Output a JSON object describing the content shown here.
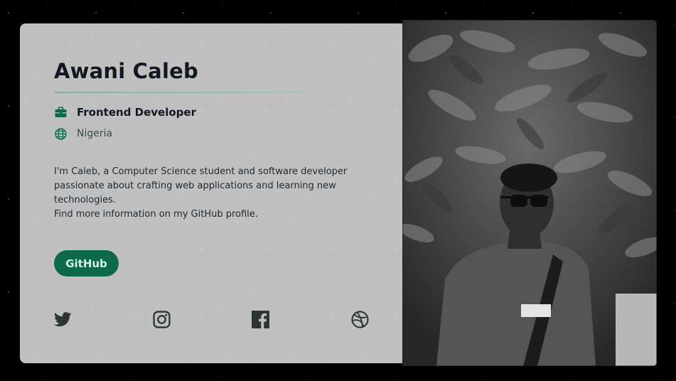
{
  "profile": {
    "name": "Awani Caleb",
    "role": "Frontend Developer",
    "location": "Nigeria",
    "bio_lines": [
      "I'm Caleb, a Computer Science student and software developer passionate about crafting web applications and learning new technologies.",
      "Find more information on my GitHub profile."
    ]
  },
  "actions": {
    "github_label": "GitHub"
  },
  "icons": {
    "role": "briefcase-icon",
    "location": "globe-icon",
    "social": [
      "twitter-icon",
      "instagram-icon",
      "facebook-icon",
      "dribbble-icon"
    ]
  },
  "colors": {
    "accent": "#0c6a4a",
    "card": "#c0c0c0",
    "text": "#111822",
    "background": "#000000",
    "icon": "#2b3535"
  },
  "photo": {
    "alt": "Grayscale photo of a person wearing sunglasses in front of leafy trees"
  }
}
